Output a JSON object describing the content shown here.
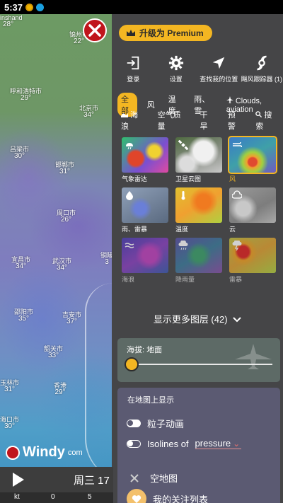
{
  "status": {
    "time": "5:37",
    "accent_1": "#f0b400",
    "accent_2": "#1aa0e0"
  },
  "map": {
    "cities": [
      {
        "name": "inshand",
        "temp": "28°",
        "pos": "c1"
      },
      {
        "name": "锦州市",
        "temp": "22°",
        "pos": "c2"
      },
      {
        "name": "呼和浩特市",
        "temp": "29°",
        "pos": "c3"
      },
      {
        "name": "北京市",
        "temp": "34°",
        "pos": "c4"
      },
      {
        "name": "吕梁市",
        "temp": "30°",
        "pos": "c5"
      },
      {
        "name": "邯郸市",
        "temp": "31°",
        "pos": "c6"
      },
      {
        "name": "周口市",
        "temp": "26°",
        "pos": "c7"
      },
      {
        "name": "宜昌市",
        "temp": "34°",
        "pos": "c8"
      },
      {
        "name": "武汉市",
        "temp": "34°",
        "pos": "c9"
      },
      {
        "name": "铜陵",
        "temp": "3",
        "pos": "c10"
      },
      {
        "name": "邵阳市",
        "temp": "35°",
        "pos": "c11"
      },
      {
        "name": "吉安市",
        "temp": "37°",
        "pos": "c12"
      },
      {
        "name": "韶关市",
        "temp": "33°",
        "pos": "c13"
      },
      {
        "name": "玉林市",
        "temp": "31°",
        "pos": "c14"
      },
      {
        "name": "香港",
        "temp": "29°",
        "pos": "c15"
      },
      {
        "name": "海口市",
        "temp": "30°",
        "pos": "c16"
      }
    ],
    "logo_text": "Windy",
    "logo_suffix": "com",
    "day_label": "周三 17",
    "scale": [
      "kt",
      "0",
      "5"
    ]
  },
  "panel": {
    "premium_label": "升级为 Premium",
    "actions": [
      {
        "label": "登录",
        "icon": "login-icon"
      },
      {
        "label": "设置",
        "icon": "gear-icon"
      },
      {
        "label": "查找我的位置",
        "icon": "location-arrow-icon"
      },
      {
        "label": "飓风跟踪器 (1)",
        "icon": "hurricane-icon"
      }
    ],
    "filter_row1": [
      "全部",
      "风",
      "温度",
      "雨、雪",
      "Clouds, aviation"
    ],
    "filter_row2": [
      "海浪",
      "空气质量",
      "干旱",
      "预警",
      "搜索"
    ],
    "layers": [
      {
        "label": "气象雷达",
        "icon": "radar-icon"
      },
      {
        "label": "卫星云图",
        "icon": "satellite-icon"
      },
      {
        "label": "风",
        "icon": "wind-icon"
      },
      {
        "label": "雨、雷暴",
        "icon": "raindrop-icon"
      },
      {
        "label": "温度",
        "icon": "thermometer-icon"
      },
      {
        "label": "云",
        "icon": "cloud-icon"
      },
      {
        "label": "海浪",
        "icon": "waves-icon"
      },
      {
        "label": "降雨量",
        "icon": "rain-cloud-icon"
      },
      {
        "label": "雷暴",
        "icon": "thunderstorm-icon"
      }
    ],
    "more_layers": "显示更多图层 (42)",
    "altitude_label": "海拔: 地面",
    "onmap_title": "在地图上显示",
    "particles_label": "粒子动画",
    "isolines_label": "Isolines of",
    "isolines_value": "pressure",
    "empty_map_label": "空地图",
    "favorites_label": "我的关注列表",
    "colors": {
      "panel": "#454547",
      "accent": "#f3b622",
      "close": "#c0151c"
    }
  }
}
